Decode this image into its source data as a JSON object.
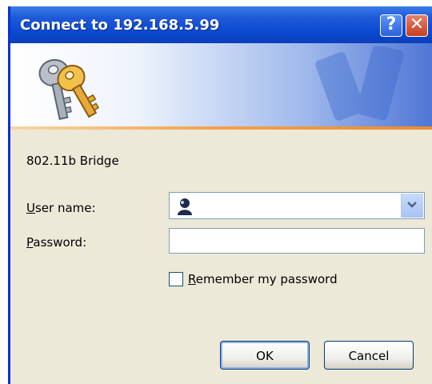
{
  "window": {
    "title": "Connect to 192.168.5.99",
    "help_glyph": "?",
    "close_glyph": "✕"
  },
  "banner": {
    "icon": "keys-icon",
    "watermark_icon": "keys-watermark-icon"
  },
  "form": {
    "realm": "802.11b Bridge",
    "username_label_ul": "U",
    "username_label_rest": "ser name:",
    "username_value": "",
    "password_label_ul": "P",
    "password_label_rest": "assword:",
    "password_value": "",
    "remember_label_ul": "R",
    "remember_label_rest": "emember my password",
    "remember_checked": false
  },
  "buttons": {
    "ok": "OK",
    "cancel": "Cancel"
  },
  "colors": {
    "titlebar": "#0a49d1",
    "dialog_bg": "#ece9d8",
    "accent_stripe": "#f3a14a"
  }
}
